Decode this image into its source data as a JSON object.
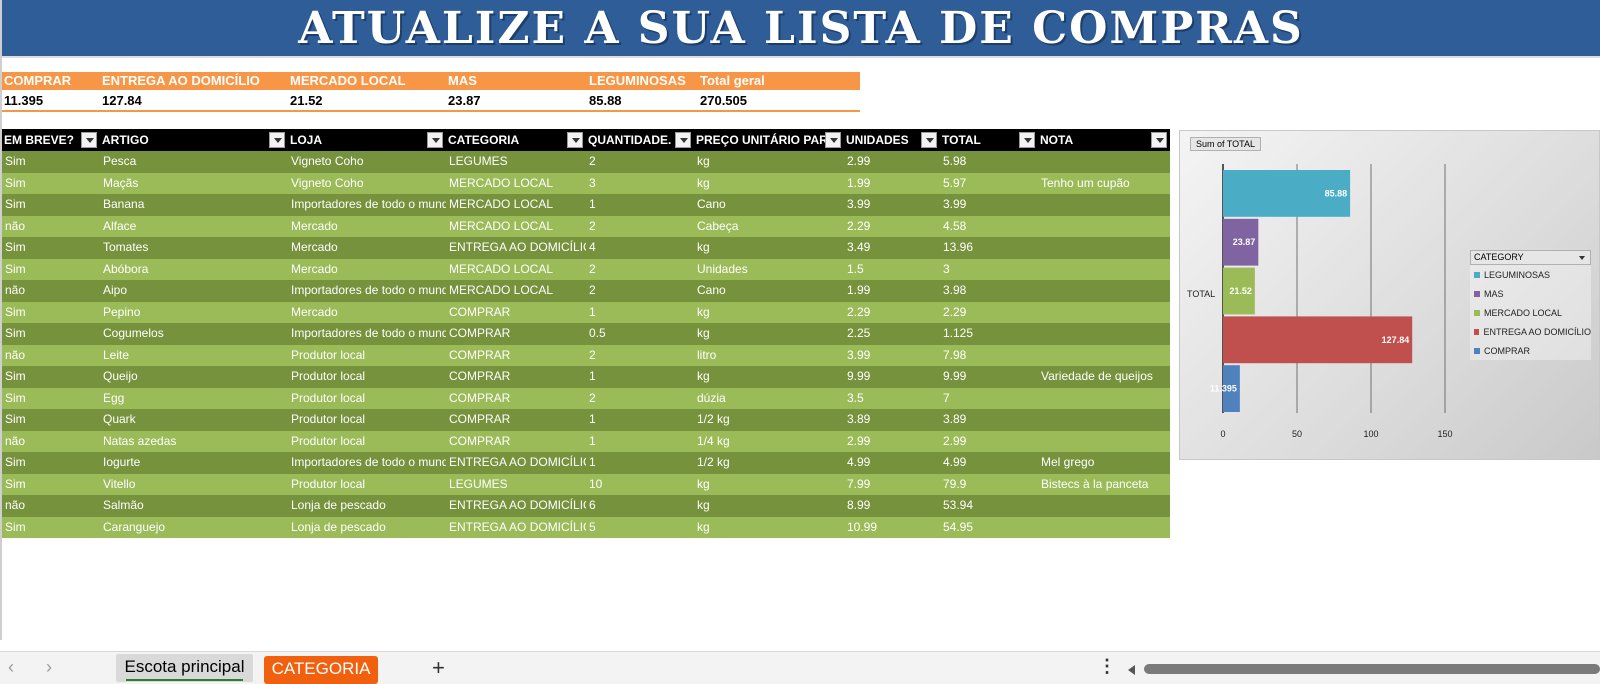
{
  "title": "ATUALIZE A SUA LISTA DE COMPRAS",
  "summary": {
    "headers": [
      "COMPRAR",
      "ENTREGA AO DOMICÍLIO",
      "MERCADO LOCAL",
      "MAS",
      "LEGUMINOSAS",
      "Total geral"
    ],
    "values": [
      "11.395",
      "127.84",
      "21.52",
      "23.87",
      "85.88",
      "270.505"
    ]
  },
  "table": {
    "headers": [
      "EM BREVE?",
      "ARTIGO",
      "LOJA",
      "CATEGORIA",
      "QUANTIDADE.",
      "PREÇO UNITÁRIO PARA",
      "UNIDADES",
      "TOTAL",
      "NOTA"
    ],
    "rows": [
      [
        "Sim",
        "Pesca",
        "Vigneto Coho",
        "LEGUMES",
        "2",
        "kg",
        "2.99",
        "5.98",
        ""
      ],
      [
        "Sim",
        "Maçãs",
        "Vigneto Coho",
        "MERCADO LOCAL",
        "3",
        "kg",
        "1.99",
        "5.97",
        "Tenho um cupão"
      ],
      [
        "Sim",
        "Banana",
        "Importadores de todo o mund",
        "MERCADO LOCAL",
        "1",
        "Cano",
        "3.99",
        "3.99",
        ""
      ],
      [
        "não",
        "Alface",
        "Mercado",
        "MERCADO LOCAL",
        "2",
        "Cabeça",
        "2.29",
        "4.58",
        ""
      ],
      [
        "Sim",
        "Tomates",
        "Mercado",
        "ENTREGA AO DOMICÍLIO",
        "4",
        "kg",
        "3.49",
        "13.96",
        ""
      ],
      [
        "Sim",
        "Abóbora",
        "Mercado",
        "MERCADO LOCAL",
        "2",
        "Unidades",
        "1.5",
        "3",
        ""
      ],
      [
        "não",
        "Aipo",
        "Importadores de todo o mund",
        "MERCADO LOCAL",
        "2",
        "Cano",
        "1.99",
        "3.98",
        ""
      ],
      [
        "Sim",
        "Pepino",
        "Mercado",
        "COMPRAR",
        "1",
        "kg",
        "2.29",
        "2.29",
        ""
      ],
      [
        "Sim",
        "Cogumelos",
        "Importadores de todo o mund",
        "COMPRAR",
        "0.5",
        "kg",
        "2.25",
        "1.125",
        ""
      ],
      [
        "não",
        "Leite",
        "Produtor local",
        "COMPRAR",
        "2",
        "litro",
        "3.99",
        "7.98",
        ""
      ],
      [
        "Sim",
        "Queijo",
        "Produtor local",
        "COMPRAR",
        "1",
        "kg",
        "9.99",
        "9.99",
        "Variedade de queijos"
      ],
      [
        "Sim",
        "Egg",
        "Produtor local",
        "COMPRAR",
        "2",
        "dúzia",
        "3.5",
        "7",
        ""
      ],
      [
        "Sim",
        "Quark",
        "Produtor local",
        "COMPRAR",
        "1",
        "1/2 kg",
        "3.89",
        "3.89",
        ""
      ],
      [
        "não",
        "Natas azedas",
        "Produtor local",
        "COMPRAR",
        "1",
        "1/4 kg",
        "2.99",
        "2.99",
        ""
      ],
      [
        "Sim",
        "Iogurte",
        "Importadores de todo o mund",
        "ENTREGA AO DOMICÍLIO",
        "1",
        "1/2 kg",
        "4.99",
        "4.99",
        "Mel grego"
      ],
      [
        "Sim",
        "Vitello",
        "Produtor local",
        "LEGUMES",
        "10",
        "kg",
        "7.99",
        "79.9",
        "Bistecs à la panceta"
      ],
      [
        "não",
        "Salmão",
        "Lonja de pescado",
        "ENTREGA AO DOMICÍLIO",
        "6",
        "kg",
        "8.99",
        "53.94",
        ""
      ],
      [
        "Sim",
        "Caranguejo",
        "Lonja de pescado",
        "ENTREGA AO DOMICÍLIO",
        "5",
        "kg",
        "10.99",
        "54.95",
        ""
      ]
    ]
  },
  "chart_data": {
    "type": "bar",
    "orientation": "horizontal",
    "field_button": "Sum of  TOTAL",
    "ylabel": "TOTAL",
    "xlim": [
      0,
      150
    ],
    "xticks": [
      "0",
      "50",
      "100",
      "150"
    ],
    "legend_title": "CATEGORY",
    "legend_position": "right",
    "series": [
      {
        "name": "LEGUMINOSAS",
        "value": 85.88,
        "label": "85.88",
        "color": "#4bacc6"
      },
      {
        "name": "MAS",
        "value": 23.87,
        "label": "23.87",
        "color": "#8064a2"
      },
      {
        "name": "MERCADO LOCAL",
        "value": 21.52,
        "label": "21.52",
        "color": "#9bbb59"
      },
      {
        "name": "ENTREGA AO DOMICÍLIO",
        "value": 127.84,
        "label": "127.84",
        "color": "#c0504d"
      },
      {
        "name": "COMPRAR",
        "value": 11.395,
        "label": "11.395",
        "color": "#4f81bd"
      }
    ]
  },
  "tabs": {
    "prev_icon": "chevron-left-icon",
    "next_icon": "chevron-right-icon",
    "active": "Escota principal",
    "second": "CATEGORIA",
    "add_icon": "plus-icon",
    "more_icon": "more-vertical-icon"
  },
  "colors": {
    "banner": "#2f5d98",
    "summary_header": "#f79646",
    "row_dark": "#76923c",
    "row_light": "#9bbb59",
    "tab_orange": "#f0600f"
  }
}
